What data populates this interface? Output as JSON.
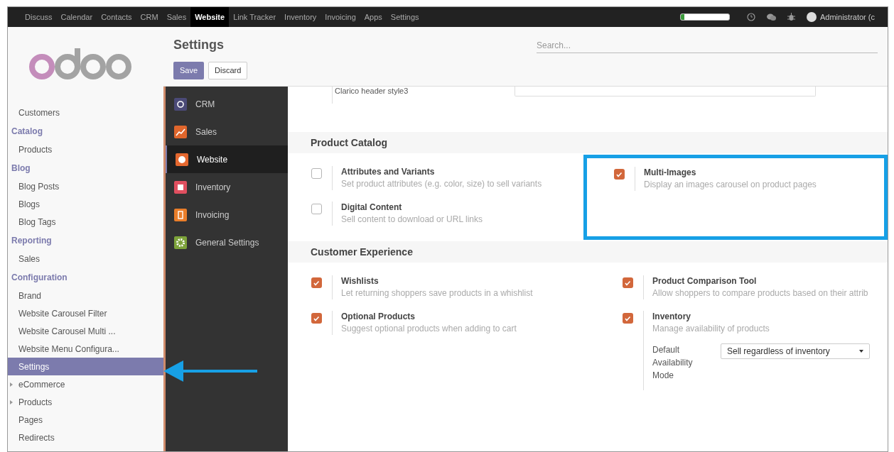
{
  "topbar": {
    "menu": [
      {
        "label": "Discuss",
        "selected": false
      },
      {
        "label": "Calendar",
        "selected": false
      },
      {
        "label": "Contacts",
        "selected": false
      },
      {
        "label": "CRM",
        "selected": false
      },
      {
        "label": "Sales",
        "selected": false
      },
      {
        "label": "Website",
        "selected": true
      },
      {
        "label": "Link Tracker",
        "selected": false
      },
      {
        "label": "Inventory",
        "selected": false
      },
      {
        "label": "Invoicing",
        "selected": false
      },
      {
        "label": "Apps",
        "selected": false
      },
      {
        "label": "Settings",
        "selected": false
      }
    ],
    "progress": {
      "level": 0.08
    },
    "user": "Administrator (c"
  },
  "sidebar": {
    "items": [
      {
        "kind": "item",
        "label": "Customers",
        "selected": false
      },
      {
        "kind": "section",
        "label": "Catalog",
        "selected": false
      },
      {
        "kind": "item",
        "label": "Products",
        "selected": false
      },
      {
        "kind": "section",
        "label": "Blog",
        "selected": false
      },
      {
        "kind": "item",
        "label": "Blog Posts",
        "selected": false
      },
      {
        "kind": "item",
        "label": "Blogs",
        "selected": false
      },
      {
        "kind": "item",
        "label": "Blog Tags",
        "selected": false
      },
      {
        "kind": "section",
        "label": "Reporting",
        "selected": false
      },
      {
        "kind": "item",
        "label": "Sales",
        "selected": false
      },
      {
        "kind": "section",
        "label": "Configuration",
        "selected": false
      },
      {
        "kind": "item",
        "label": "Brand",
        "selected": false
      },
      {
        "kind": "item",
        "label": "Website Carousel Filter",
        "selected": false
      },
      {
        "kind": "item",
        "label": "Website Carousel Multi ...",
        "selected": false
      },
      {
        "kind": "item",
        "label": "Website Menu Configura...",
        "selected": false
      },
      {
        "kind": "item",
        "label": "Settings",
        "selected": true
      },
      {
        "kind": "folder",
        "label": "eCommerce",
        "selected": false
      },
      {
        "kind": "folder",
        "label": "Products",
        "selected": false
      },
      {
        "kind": "item",
        "label": "Pages",
        "selected": false
      },
      {
        "kind": "item",
        "label": "Redirects",
        "selected": false
      }
    ]
  },
  "header": {
    "title": "Settings",
    "save": "Save",
    "discard": "Discard",
    "search": {
      "placeholder": "Search..."
    }
  },
  "apps": [
    {
      "label": "CRM",
      "selected": false,
      "color": "#4b4a77"
    },
    {
      "label": "Sales",
      "selected": false,
      "color": "#e0662c"
    },
    {
      "label": "Website",
      "selected": true,
      "color": "#e5682f"
    },
    {
      "label": "Inventory",
      "selected": false,
      "color": "#e04f5f"
    },
    {
      "label": "Invoicing",
      "selected": false,
      "color": "#ea7e2a"
    },
    {
      "label": "General Settings",
      "selected": false,
      "color": "#7da33a"
    }
  ],
  "partial_setting": {
    "label": "Clarico header style3"
  },
  "sections": [
    {
      "title": "Product Catalog",
      "highlight_right": true,
      "left": [
        {
          "title": "Attributes and Variants",
          "description": "Set product attributes (e.g. color, size) to sell variants",
          "checked": false
        },
        {
          "title": "Digital Content",
          "description": "Sell content to download or URL links",
          "checked": false
        }
      ],
      "right": [
        {
          "title": "Multi-Images",
          "description": "Display an images carousel on product pages",
          "checked": true
        }
      ]
    },
    {
      "title": "Customer Experience",
      "highlight_right": false,
      "left": [
        {
          "title": "Wishlists",
          "description": "Let returning shoppers save products in a whishlist",
          "checked": true
        },
        {
          "title": "Optional Products",
          "description": "Suggest optional products when adding to cart",
          "checked": true
        }
      ],
      "right": [
        {
          "title": "Product Comparison Tool",
          "description": "Allow shoppers to compare products based on their attrib",
          "checked": true
        },
        {
          "title": "Inventory",
          "description": "Manage availability of products",
          "checked": true,
          "field": {
            "label": "Default Availability Mode",
            "value": "Sell regardless of inventory"
          }
        }
      ]
    }
  ]
}
